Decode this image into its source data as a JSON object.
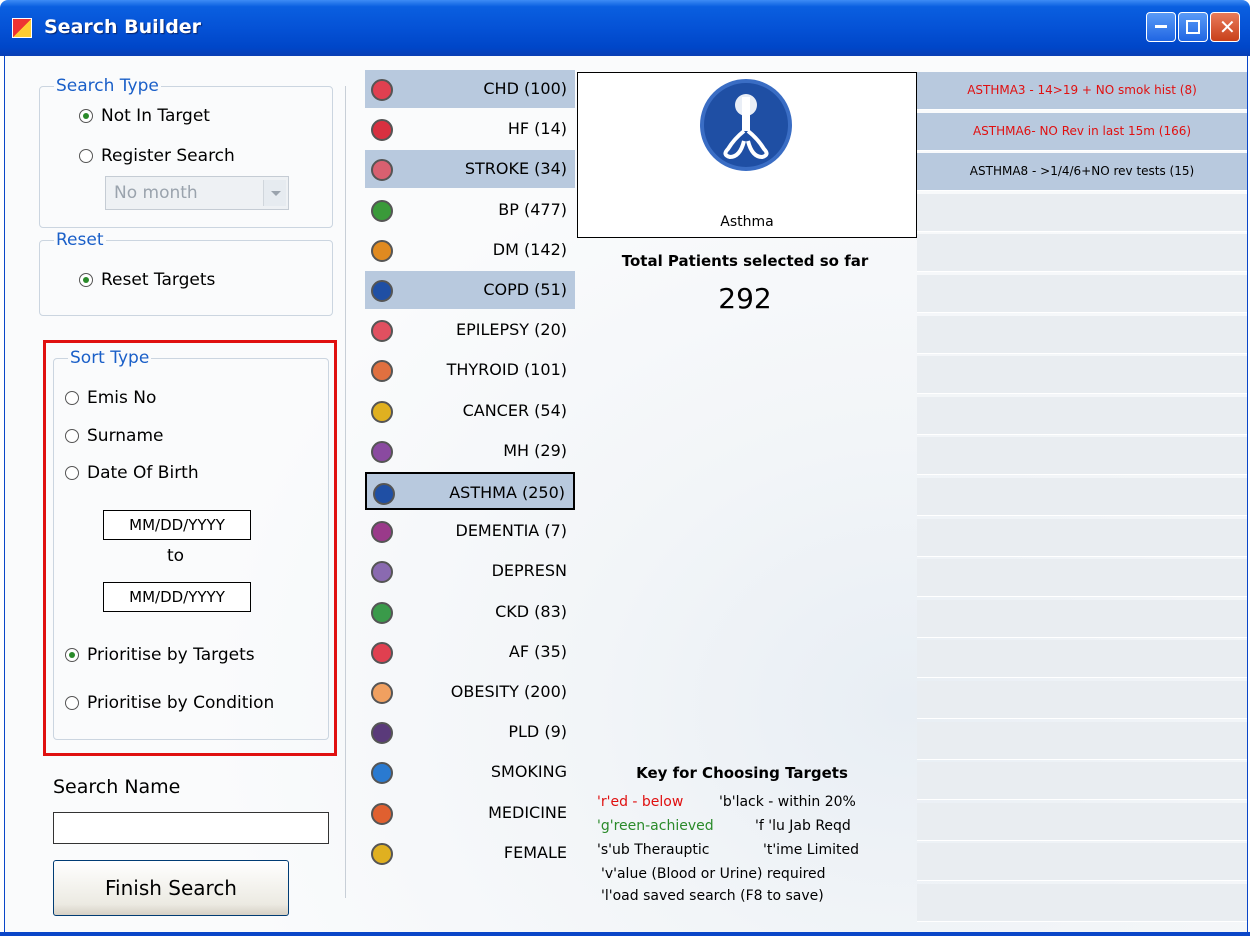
{
  "window": {
    "title": "Search Builder"
  },
  "search_type": {
    "legend": "Search Type",
    "options": [
      "Not In Target",
      "Register Search"
    ],
    "selected": "Not In Target",
    "month_select": "No month"
  },
  "reset": {
    "legend": "Reset",
    "option": "Reset Targets"
  },
  "sort_type": {
    "legend": "Sort Type",
    "options": [
      "Emis No",
      "Surname",
      "Date Of Birth"
    ],
    "date_from_placeholder": "MM/DD/YYYY",
    "to": "to",
    "date_to_placeholder": "MM/DD/YYYY",
    "prioritise": [
      "Prioritise by Targets",
      "Prioritise by Condition"
    ],
    "selected": "Prioritise by Targets"
  },
  "search_name": {
    "label": "Search Name",
    "value": ""
  },
  "finish_button": "Finish Search",
  "conditions": [
    {
      "label": "CHD (100)",
      "icon": "heart-icon",
      "color": "#e04050",
      "highlight": true
    },
    {
      "label": "HF (14)",
      "icon": "hf-icon",
      "color": "#d83040",
      "highlight": false
    },
    {
      "label": "STROKE (34)",
      "icon": "brain-icon",
      "color": "#d86070",
      "highlight": true
    },
    {
      "label": "BP (477)",
      "icon": "thermometer-icon",
      "color": "#3a9a3a",
      "highlight": false
    },
    {
      "label": "DM (142)",
      "icon": "syringe-icon",
      "color": "#e08a20",
      "highlight": false
    },
    {
      "label": "COPD (51)",
      "icon": "lungs-icon",
      "color": "#1f4fa4",
      "highlight": true
    },
    {
      "label": "EPILEPSY (20)",
      "icon": "epilepsy-icon",
      "color": "#e05060",
      "highlight": false
    },
    {
      "label": "THYROID (101)",
      "icon": "thyroid-icon",
      "color": "#e07040",
      "highlight": false
    },
    {
      "label": "CANCER (54)",
      "icon": "radiation-icon",
      "color": "#e0b020",
      "highlight": false
    },
    {
      "label": "MH (29)",
      "icon": "mental-health-icon",
      "color": "#8a4aa0",
      "highlight": false
    },
    {
      "label": "ASTHMA (250)",
      "icon": "lungs-icon",
      "color": "#1f4fa4",
      "highlight": true,
      "selected": true
    },
    {
      "label": "DEMENTIA (7)",
      "icon": "dementia-icon",
      "color": "#9a3a8a",
      "highlight": false
    },
    {
      "label": "DEPRESN",
      "icon": "depression-icon",
      "color": "#8a6ab0",
      "highlight": false
    },
    {
      "label": "CKD (83)",
      "icon": "kidney-icon",
      "color": "#3a9a4a",
      "highlight": false
    },
    {
      "label": "AF (35)",
      "icon": "heartbeat-icon",
      "color": "#e04050",
      "highlight": false
    },
    {
      "label": "OBESITY (200)",
      "icon": "obesity-icon",
      "color": "#f0a060",
      "highlight": false
    },
    {
      "label": "PLD (9)",
      "icon": "iq-icon",
      "color": "#5a3a7a",
      "highlight": false
    },
    {
      "label": "SMOKING",
      "icon": "smoking-icon",
      "color": "#2a7ad0",
      "highlight": false
    },
    {
      "label": "MEDICINE",
      "icon": "medicine-icon",
      "color": "#e06030",
      "highlight": false
    },
    {
      "label": "FEMALE",
      "icon": "female-icon",
      "color": "#e0b020",
      "highlight": false
    }
  ],
  "preview": {
    "caption": "Asthma",
    "icon": "lungs-icon"
  },
  "total": {
    "label": "Total Patients selected so far",
    "value": "292"
  },
  "key": {
    "title": "Key for Choosing Targets",
    "rows": [
      {
        "left": "'r'ed - below",
        "left_color": "red",
        "right": "'b'lack - within 20%"
      },
      {
        "left": "'g'reen-achieved",
        "left_color": "green",
        "right": "'f 'lu Jab Reqd"
      },
      {
        "left": "'s'ub Therauptic",
        "left_color": "black",
        "right": "'t'ime Limited"
      }
    ],
    "line4": "'v'alue (Blood or Urine) required",
    "line5": "'l'oad saved search (F8 to save)"
  },
  "targets": [
    {
      "text": "ASTHMA3 - 14>19 + NO smok hist (8)",
      "color": "#e01010"
    },
    {
      "text": "ASTHMA6- NO Rev in last 15m (166)",
      "color": "#e01010"
    },
    {
      "text": "ASTHMA8 - >1/4/6+NO rev tests (15)",
      "color": "#000000"
    }
  ],
  "target_blank_rows": 18
}
